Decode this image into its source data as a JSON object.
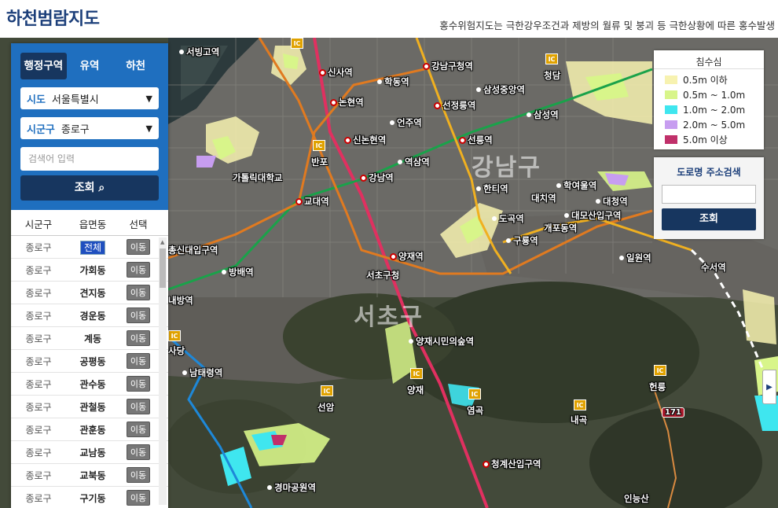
{
  "header": {
    "title": "하천범람지도",
    "subtitle": "홍수위험지도는 극한강우조건과 제방의 월류 및 붕괴 등 극한상황에 따른 홍수발생"
  },
  "panel": {
    "tabs": [
      "행정구역",
      "유역",
      "하천"
    ],
    "sido_label": "시도",
    "sido_value": "서울특별시",
    "sigungu_label": "시군구",
    "sigungu_value": "종로구",
    "search_placeholder": "검색어 입력",
    "query_button": "조회",
    "table_headers": [
      "시군구",
      "읍면동",
      "선택"
    ],
    "rows": [
      {
        "sigungu": "종로구",
        "dong": "전체",
        "action": "이동"
      },
      {
        "sigungu": "종로구",
        "dong": "가회동",
        "action": "이동"
      },
      {
        "sigungu": "종로구",
        "dong": "견지동",
        "action": "이동"
      },
      {
        "sigungu": "종로구",
        "dong": "경운동",
        "action": "이동"
      },
      {
        "sigungu": "종로구",
        "dong": "계동",
        "action": "이동"
      },
      {
        "sigungu": "종로구",
        "dong": "공평동",
        "action": "이동"
      },
      {
        "sigungu": "종로구",
        "dong": "관수동",
        "action": "이동"
      },
      {
        "sigungu": "종로구",
        "dong": "관철동",
        "action": "이동"
      },
      {
        "sigungu": "종로구",
        "dong": "관훈동",
        "action": "이동"
      },
      {
        "sigungu": "종로구",
        "dong": "교남동",
        "action": "이동"
      },
      {
        "sigungu": "종로구",
        "dong": "교북동",
        "action": "이동"
      },
      {
        "sigungu": "종로구",
        "dong": "구기동",
        "action": "이동"
      }
    ]
  },
  "legend": {
    "title": "침수심",
    "items": [
      {
        "label": "0.5m 이하",
        "color": "#f7f2b0"
      },
      {
        "label": "0.5m ~ 1.0m",
        "color": "#d8f58a"
      },
      {
        "label": "1.0m ~ 2.0m",
        "color": "#3fe6ef"
      },
      {
        "label": "2.0m ~ 5.0m",
        "color": "#c79df0"
      },
      {
        "label": "5.0m 이상",
        "color": "#c0306a"
      }
    ]
  },
  "road_search": {
    "title": "도로명 주소검색",
    "button": "조회"
  },
  "map": {
    "districts": [
      "강남구",
      "서초구"
    ],
    "stations": [
      "신사역",
      "논현역",
      "신논현역",
      "강남역",
      "교대역",
      "양재역",
      "선릉역",
      "선정릉역",
      "강남구청역",
      "역삼역",
      "한티역",
      "도곡역",
      "대치역",
      "학여울역",
      "대청역",
      "대모산입구역",
      "개포동역",
      "구룡역",
      "일원역",
      "수서역",
      "삼성역",
      "삼성중앙역",
      "방배역",
      "내방역",
      "남태령역",
      "경마공원역",
      "양재시민의숲역",
      "청계산입구역",
      "총신대입구역"
    ],
    "places": [
      "서빙고역",
      "학동역",
      "언주역",
      "가톨릭대학교",
      "서초구청",
      "반포",
      "양재",
      "선암",
      "염곡",
      "내곡",
      "헌릉",
      "인능산",
      "사당",
      "청담"
    ],
    "highway_shield": "171",
    "ic_text": "IC"
  }
}
